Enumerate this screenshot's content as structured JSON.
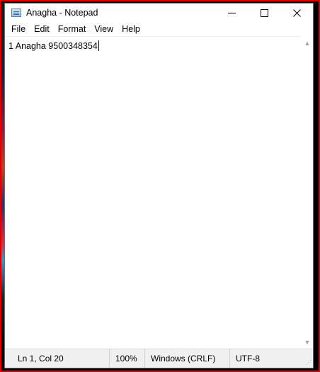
{
  "window": {
    "title": "Anagha - Notepad",
    "controls": {
      "minimize": "—",
      "maximize": "☐",
      "close": "✕"
    }
  },
  "menu": [
    "File",
    "Edit",
    "Format",
    "View",
    "Help"
  ],
  "editor": {
    "content": "1 Anagha 9500348354"
  },
  "status": {
    "position": "Ln 1, Col 20",
    "zoom": "100%",
    "line_endings": "Windows (CRLF)",
    "encoding": "UTF-8"
  },
  "colors": {
    "frame_highlight": "#e00000",
    "statusbar_bg": "#f0f0f0"
  }
}
